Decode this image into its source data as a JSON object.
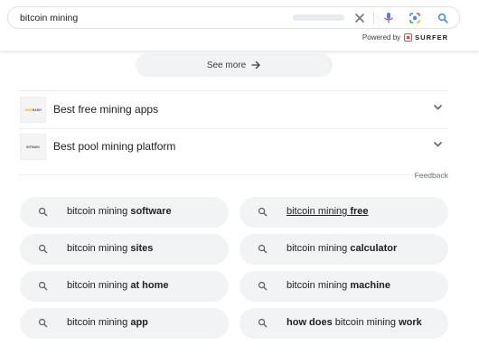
{
  "search": {
    "query": "bitcoin mining"
  },
  "powered_by": {
    "label": "Powered by",
    "brand": "SURFER"
  },
  "see_more": {
    "label": "See more"
  },
  "accordion": [
    {
      "label": "Best free mining apps",
      "thumb_text_a": "NICE",
      "thumb_text_b": "HASH"
    },
    {
      "label": "Best pool mining platform",
      "thumb_text": "BITMAIN"
    }
  ],
  "feedback": {
    "label": "Feedback"
  },
  "related": [
    {
      "plain": "bitcoin mining ",
      "bold": "software",
      "plain_after": "",
      "bold_prefix": "",
      "underlined": false
    },
    {
      "plain": "bitcoin mining ",
      "bold": "free",
      "plain_after": "",
      "bold_prefix": "",
      "underlined": true
    },
    {
      "plain": "bitcoin mining ",
      "bold": "sites",
      "plain_after": "",
      "bold_prefix": "",
      "underlined": false
    },
    {
      "plain": "bitcoin mining ",
      "bold": "calculator",
      "plain_after": "",
      "bold_prefix": "",
      "underlined": false
    },
    {
      "plain": "bitcoin mining ",
      "bold": "at home",
      "plain_after": "",
      "bold_prefix": "",
      "underlined": false
    },
    {
      "plain": "bitcoin mining ",
      "bold": "machine",
      "plain_after": "",
      "bold_prefix": "",
      "underlined": false
    },
    {
      "plain": "bitcoin mining ",
      "bold": "app",
      "plain_after": "",
      "bold_prefix": "",
      "underlined": false
    },
    {
      "bold_prefix": "how does",
      "plain": " bitcoin mining ",
      "bold": "work",
      "plain_after": "",
      "underlined": false
    }
  ],
  "icons": {
    "clear": "close-icon",
    "mic": "microphone-icon",
    "lens": "camera-lens-icon",
    "search": "search-icon",
    "arrow": "arrow-right-icon",
    "chevron": "chevron-down-icon",
    "magnifier": "search-icon"
  },
  "colors": {
    "google_blue": "#4285f4",
    "google_red": "#ea4335",
    "google_yellow": "#fbbc04",
    "google_green": "#34a853",
    "chip_bg": "#f1f3f4",
    "surfer_red": "#e8453c"
  }
}
